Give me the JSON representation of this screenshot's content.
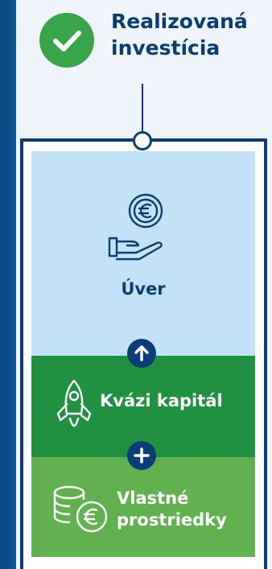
{
  "header": {
    "title_line1": "Realizovaná",
    "title_line2": "investícia",
    "icon": "check-circle-icon"
  },
  "diagram": {
    "blocks": [
      {
        "label": "Úver",
        "icon": "euro-hand-icon",
        "color": "#c3e2f7"
      },
      {
        "label": "Kvázi kapitál",
        "icon": "rocket-icon",
        "color": "#1f9140"
      },
      {
        "label_line1": "Vlastné",
        "label_line2": "prostriedky",
        "icon": "euro-coins-icon",
        "color": "#62b151"
      }
    ],
    "connectors": [
      {
        "icon": "arrow-up-icon"
      },
      {
        "icon": "plus-icon"
      }
    ],
    "accent_color": "#0a3d78",
    "check_color": "#39a54a"
  }
}
